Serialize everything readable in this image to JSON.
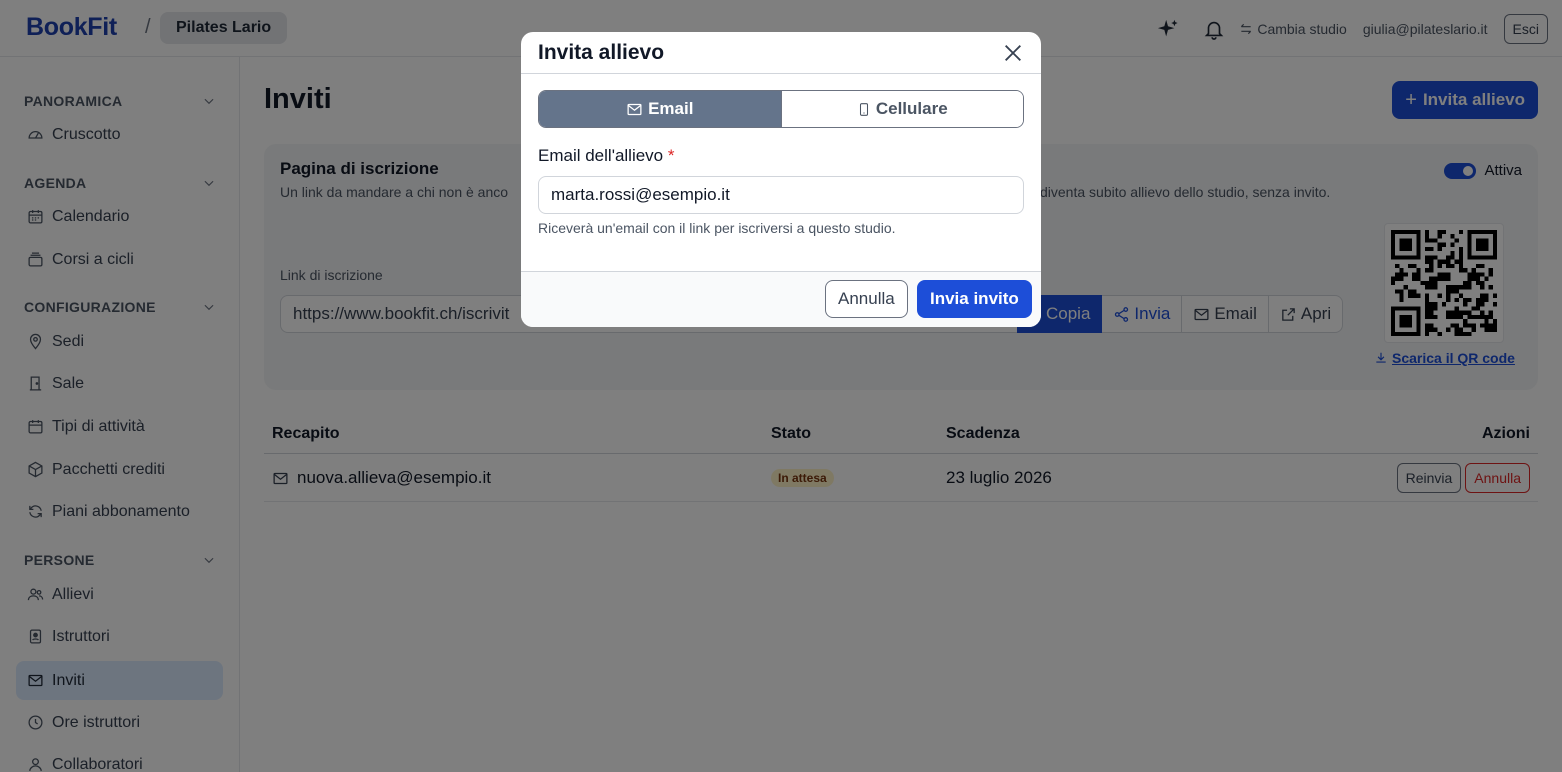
{
  "app": {
    "logo": "BookFit",
    "separator": "/",
    "studio": "Pilates Lario"
  },
  "topbar": {
    "switch_studio": "Cambia studio",
    "user_email": "giulia@pilateslario.it",
    "logout": "Esci"
  },
  "sidebar": {
    "sections": [
      {
        "title": "PANORAMICA",
        "items": [
          {
            "label": "Cruscotto",
            "icon": "gauge-icon"
          }
        ]
      },
      {
        "title": "AGENDA",
        "items": [
          {
            "label": "Calendario",
            "icon": "calendar-icon"
          },
          {
            "label": "Corsi a cicli",
            "icon": "stack-icon"
          }
        ]
      },
      {
        "title": "CONFIGURAZIONE",
        "items": [
          {
            "label": "Sedi",
            "icon": "map-pin-icon"
          },
          {
            "label": "Sale",
            "icon": "door-icon"
          },
          {
            "label": "Tipi di attività",
            "icon": "calendar-blank-icon"
          },
          {
            "label": "Pacchetti crediti",
            "icon": "package-icon"
          },
          {
            "label": "Piani abbonamento",
            "icon": "refresh-icon"
          }
        ]
      },
      {
        "title": "PERSONE",
        "items": [
          {
            "label": "Allievi",
            "icon": "users-icon"
          },
          {
            "label": "Istruttori",
            "icon": "badge-icon"
          },
          {
            "label": "Inviti",
            "icon": "mail-icon",
            "active": true
          },
          {
            "label": "Ore istruttori",
            "icon": "clock-icon"
          },
          {
            "label": "Collaboratori",
            "icon": "user-icon"
          }
        ]
      }
    ]
  },
  "main": {
    "title": "Inviti",
    "invite_button": "Invita allievo",
    "signup_card": {
      "title": "Pagina di iscrizione",
      "description_left": "Un link da mandare a chi non è anco",
      "description_right": "diventa subito allievo dello studio, senza invito.",
      "toggle_label": "Attiva",
      "link_label": "Link di iscrizione",
      "link_value": "https://www.bookfit.ch/iscrivit",
      "actions": {
        "copy": "Copia",
        "share": "Invia",
        "email": "Email",
        "open": "Apri"
      },
      "qr_download": "Scarica il QR code"
    },
    "table": {
      "headers": {
        "recipient": "Recapito",
        "status": "Stato",
        "expiry": "Scadenza",
        "actions": "Azioni"
      },
      "rows": [
        {
          "recipient": "nuova.allieva@esempio.it",
          "status": "In attesa",
          "expiry": "23 luglio 2026",
          "resend": "Reinvia",
          "cancel": "Annulla"
        }
      ]
    }
  },
  "modal": {
    "title": "Invita allievo",
    "tabs": {
      "email": "Email",
      "phone": "Cellulare"
    },
    "field_label": "Email dell'allievo",
    "required_mark": "*",
    "field_value": "marta.rossi@esempio.it",
    "help": "Riceverà un'email con il link per iscriversi a questo studio.",
    "cancel": "Annulla",
    "submit": "Invia invito"
  }
}
